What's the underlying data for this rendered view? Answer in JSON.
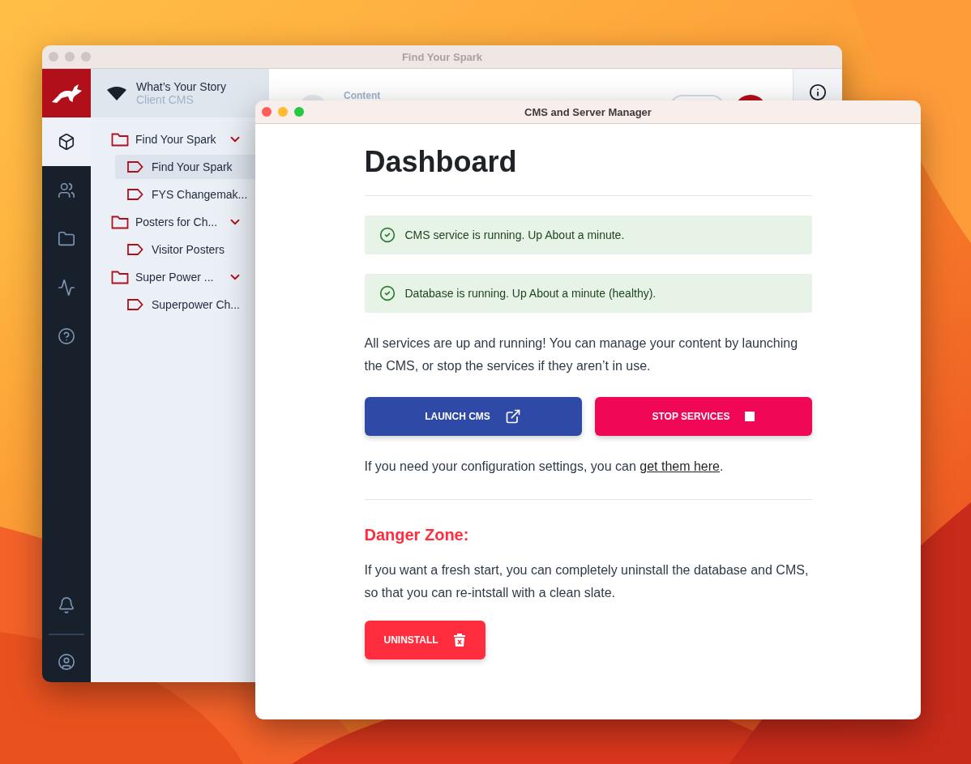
{
  "back_window": {
    "title": "Find Your Spark",
    "rail": [
      {
        "selected": true
      },
      {
        "selected": false
      },
      {
        "selected": false
      },
      {
        "selected": false
      },
      {
        "selected": false
      }
    ],
    "rail_bottom": [
      {
        "selected": false
      },
      {
        "selected": false
      }
    ],
    "project": {
      "name": "What’s Your Story",
      "subtitle": "Client CMS"
    },
    "tree": [
      {
        "label": "Find Your Spark",
        "expanded": true,
        "selected": false,
        "children": [
          {
            "label": "Find Your Spark",
            "selected": true
          },
          {
            "label": "FYS Changemak...",
            "selected": false
          }
        ]
      },
      {
        "label": "Posters for Ch...",
        "expanded": true,
        "selected": false,
        "children": [
          {
            "label": "Visitor Posters",
            "selected": false
          }
        ]
      },
      {
        "label": "Super Power ...",
        "expanded": true,
        "selected": false,
        "children": [
          {
            "label": "Superpower Ch...",
            "selected": false
          }
        ]
      }
    ],
    "header_label": "Content"
  },
  "front_window": {
    "title": "CMS and Server Manager",
    "heading": "Dashboard",
    "alerts": [
      {
        "kind": "success",
        "text": "CMS service is running. Up About a minute."
      },
      {
        "kind": "success",
        "text": "Database is running. Up About a minute (healthy)."
      }
    ],
    "summary": "All services are up and running! You can manage your content by launching the CMS, or stop the services if they aren’t in use.",
    "buttons": [
      {
        "kind": "launch",
        "label": "LAUNCH CMS"
      },
      {
        "kind": "stop",
        "label": "STOP SERVICES"
      }
    ],
    "config_text": "If you need your configuration settings, you can ",
    "config_link": "get them here",
    "config_end": ".",
    "danger_title": "Danger Zone:",
    "danger_text": "If you want a fresh start, you can completely uninstall the database and CMS, so that you can re-intstall with a clean slate.",
    "danger_button": {
      "kind": "uninstall",
      "label": "UNINSTALL"
    }
  }
}
